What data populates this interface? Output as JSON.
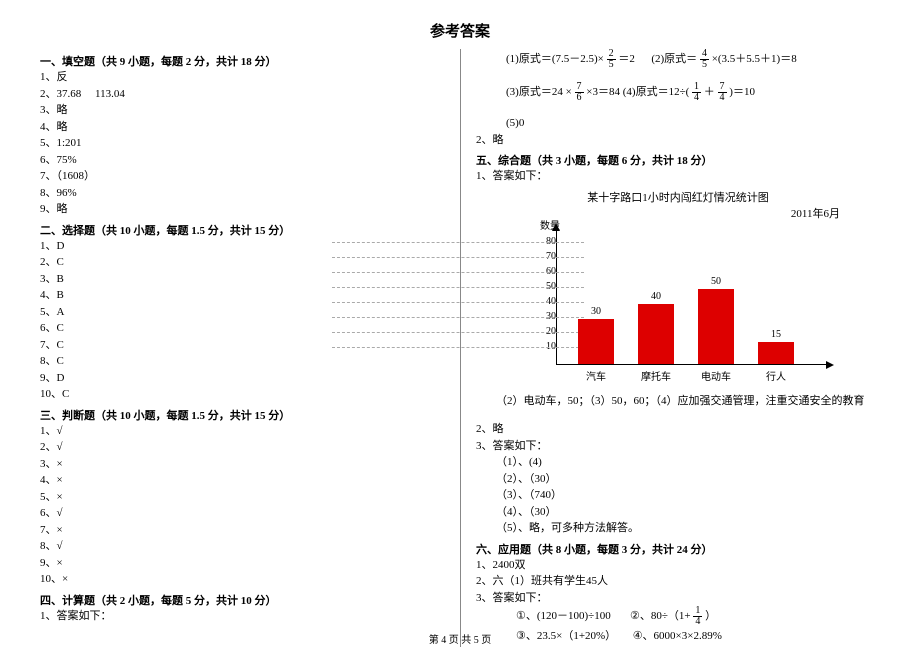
{
  "title": "参考答案",
  "left": {
    "sec1_head": "一、填空题（共 9 小题，每题 2 分，共计 18 分）",
    "sec1_items": [
      "1、反",
      "2、37.68     113.04",
      "3、略",
      "4、略",
      "5、1:201",
      "6、75%",
      "7、（1608）",
      "8、96%",
      "9、略"
    ],
    "sec2_head": "二、选择题（共 10 小题，每题 1.5 分，共计 15 分）",
    "sec2_items": [
      "1、D",
      "2、C",
      "3、B",
      "4、B",
      "5、A",
      "6、C",
      "7、C",
      "8、C",
      "9、D",
      "10、C"
    ],
    "sec3_head": "三、判断题（共 10 小题，每题 1.5 分，共计 15 分）",
    "sec3_items": [
      "1、√",
      "2、√",
      "3、×",
      "4、×",
      "5、×",
      "6、√",
      "7、×",
      "8、√",
      "9、×",
      "10、×"
    ],
    "sec4_head": "四、计算题（共 2 小题，每题 5 分，共计 10 分）",
    "sec4_items": [
      "1、答案如下："
    ]
  },
  "right": {
    "eq1_prefix": "(1)原式＝(7.5－2.5)×",
    "eq1_frac_n": "2",
    "eq1_frac_d": "5",
    "eq1_suffix": "＝2",
    "eq2_prefix": "(2)原式＝",
    "eq2_frac_n": "4",
    "eq2_frac_d": "5",
    "eq2_mid": "×(3.5＋5.5＋1)＝8",
    "eq3_prefix": "(3)原式＝24 ×",
    "eq3_frac_n": "7",
    "eq3_frac_d": "6",
    "eq3_suffix": "×3＝84",
    "eq4_prefix": "(4)原式＝12÷(",
    "eq4_frac1_n": "1",
    "eq4_frac1_d": "4",
    "eq4_plus": "＋",
    "eq4_frac2_n": "7",
    "eq4_frac2_d": "4",
    "eq4_suffix": ")＝10",
    "eq5": "(5)0",
    "item2": "2、略",
    "sec5_head": "五、综合题（共 3 小题，每题 6 分，共计 18 分）",
    "sec5_1": "1、答案如下：",
    "chart_analysis": "（2）电动车，50；（3）50，60；（4）应加强交通管理，注重交通安全的教育",
    "sec5_2": "2、略",
    "sec5_3": "3、答案如下：",
    "sec5_3_items": [
      "（1）、(4)",
      "（2）、（30）",
      "（3）、（740）",
      "（4）、（30）",
      "（5）、略，可多种方法解答。"
    ],
    "sec6_head": "六、应用题（共 8 小题，每题 3 分，共计 24 分）",
    "sec6_items": [
      "1、2400双",
      "2、六（1）班共有学生45人",
      "3、答案如下："
    ],
    "eq_row1_a": "①、(120－100)÷100",
    "eq_row1_b_prefix": "②、80÷（1+",
    "eq_row1_b_frac_n": "1",
    "eq_row1_b_frac_d": "4",
    "eq_row1_b_suffix": "）",
    "eq_row2_a": "③、23.5×（1+20%）",
    "eq_row2_b": "④、6000×3×2.89%"
  },
  "chart_data": {
    "type": "bar",
    "title": "某十字路口1小时内闯红灯情况统计图",
    "subtitle": "2011年6月",
    "ylabel": "数量",
    "ylim": [
      0,
      80
    ],
    "ticks": [
      10,
      20,
      30,
      40,
      50,
      60,
      70,
      80
    ],
    "categories": [
      "汽车",
      "摩托车",
      "电动车",
      "行人"
    ],
    "values": [
      30,
      40,
      50,
      15
    ]
  },
  "footer": "第 4 页 共 5 页"
}
